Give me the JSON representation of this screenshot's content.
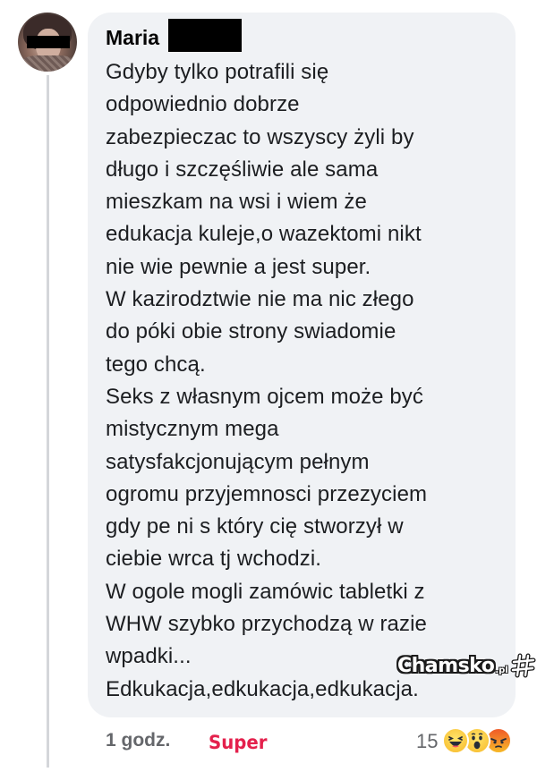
{
  "comment": {
    "author_visible": "Maria",
    "text_lines": [
      "Gdyby tylko potrafili się",
      "odpowiednio dobrze",
      "zabezpieczac to wszyscy żyli by",
      "długo i szczęśliwie ale sama",
      "mieszkam na wsi i wiem że",
      "edukacja kuleje,o wazektomi nikt",
      "nie wie pewnie a jest super.",
      "W kazirodztwie nie ma nic złego",
      "do póki obie strony swiadomie",
      "tego chcą.",
      "Seks z własnym ojcem może być",
      "mistycznym mega",
      "satysfakcjonującym pełnym",
      "ogromu przyjemnosci przezyciem",
      "gdy pe ni s który cię stworzył w",
      "ciebie wrca tj wchodzi.",
      "W ogole mogli zamówic tabletki z",
      "WHW szybko przychodzą w razie",
      "wpadki...",
      "Edkukacja,edkukacja,edkukacja."
    ]
  },
  "footer": {
    "time": "1 godz.",
    "reaction_label": "Super",
    "reaction_count": "15"
  },
  "reactions": [
    "laugh-emoji",
    "wow-emoji",
    "angry-emoji"
  ],
  "watermark": {
    "text": "Chamsko",
    "suffix": ".pl"
  },
  "colors": {
    "bubble": "#f0f2f5",
    "super_label": "#e4204c",
    "meta_text": "#65676b"
  }
}
